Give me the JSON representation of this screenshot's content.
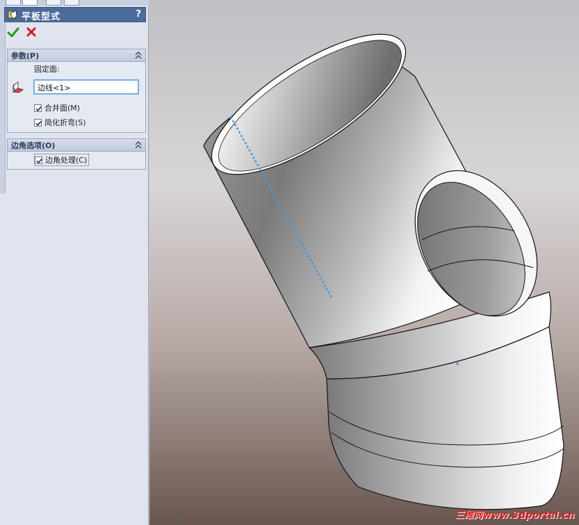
{
  "panel": {
    "title": "平板型式",
    "help": "?",
    "groups": {
      "params": {
        "title": "参数(P)",
        "fixed_face_label": "固定面:",
        "fixed_face_value": "边线<1>",
        "merge_faces": {
          "label": "合并面(M)",
          "checked": true
        },
        "simplify_bends": {
          "label": "简化折弯(S)",
          "checked": true
        }
      },
      "corner": {
        "title": "边角选项(O)",
        "corner_treatment": {
          "label": "边角处理(C)",
          "checked": true
        }
      }
    }
  },
  "icons": {
    "ok": "check-icon",
    "cancel": "close-icon",
    "feature": "flat-pattern-icon",
    "collapse": "double-chevron-up-icon",
    "fixed_face": "face-select-icon"
  },
  "colors": {
    "header_bg": "#4c6c9c",
    "ok_green": "#1f9a1f",
    "cancel_red": "#d21a1a",
    "selection_blue": "#3a9be8",
    "watermark_red": "#e21a1a"
  },
  "viewport": {
    "watermark": "三维网www.3dportal.cn"
  }
}
